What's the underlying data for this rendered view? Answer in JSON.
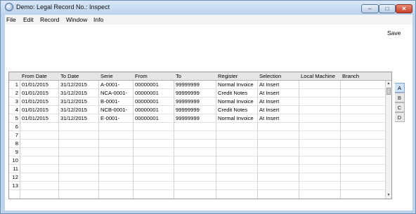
{
  "window": {
    "title": "Demo: Legal Record No.: Inspect"
  },
  "menubar": [
    "File",
    "Edit",
    "Record",
    "Window",
    "Info"
  ],
  "toolbar": {
    "save_label": "Save"
  },
  "grid": {
    "columns": [
      "From Date",
      "To Date",
      "Serie",
      "From",
      "To",
      "Register",
      "Selection",
      "Local Machine",
      "Branch"
    ],
    "rows": [
      {
        "num": "1",
        "cells": [
          "01/01/2015",
          "31/12/2015",
          "A-0001-",
          "00000001",
          "99999999",
          "Normal Invoice",
          "At Insert",
          "",
          ""
        ]
      },
      {
        "num": "2",
        "cells": [
          "01/01/2015",
          "31/12/2015",
          "NCA-0001-",
          "00000001",
          "99999999",
          "Credit Notes",
          "At Insert",
          "",
          ""
        ]
      },
      {
        "num": "3",
        "cells": [
          "01/01/2015",
          "31/12/2015",
          "B-0001-",
          "00000001",
          "99999999",
          "Normal Invoice",
          "At Insert",
          "",
          ""
        ]
      },
      {
        "num": "4",
        "cells": [
          "01/01/2015",
          "31/12/2015",
          "NCB-0001-",
          "00000001",
          "99999999",
          "Credit Notes",
          "At Insert",
          "",
          ""
        ]
      },
      {
        "num": "5",
        "cells": [
          "01/01/2015",
          "31/12/2015",
          "E-0001-",
          "00000001",
          "99999999",
          "Normal Invoice",
          "At Insert",
          "",
          ""
        ]
      },
      {
        "num": "6",
        "cells": [
          "",
          "",
          "",
          "",
          "",
          "",
          "",
          "",
          ""
        ]
      },
      {
        "num": "7",
        "cells": [
          "",
          "",
          "",
          "",
          "",
          "",
          "",
          "",
          ""
        ]
      },
      {
        "num": "8",
        "cells": [
          "",
          "",
          "",
          "",
          "",
          "",
          "",
          "",
          ""
        ]
      },
      {
        "num": "9",
        "cells": [
          "",
          "",
          "",
          "",
          "",
          "",
          "",
          "",
          ""
        ]
      },
      {
        "num": "10",
        "cells": [
          "",
          "",
          "",
          "",
          "",
          "",
          "",
          "",
          ""
        ]
      },
      {
        "num": "11",
        "cells": [
          "",
          "",
          "",
          "",
          "",
          "",
          "",
          "",
          ""
        ]
      },
      {
        "num": "12",
        "cells": [
          "",
          "",
          "",
          "",
          "",
          "",
          "",
          "",
          ""
        ]
      },
      {
        "num": "13",
        "cells": [
          "",
          "",
          "",
          "",
          "",
          "",
          "",
          "",
          ""
        ]
      }
    ]
  },
  "tabs": [
    {
      "label": "A",
      "active": true
    },
    {
      "label": "B",
      "active": false
    },
    {
      "label": "C",
      "active": false
    },
    {
      "label": "D",
      "active": false
    }
  ],
  "icons": {
    "app": "app-icon",
    "minimize": "minimize-icon",
    "maximize": "maximize-icon",
    "close": "close-icon",
    "scroll_up": "scroll-up-arrow-icon",
    "scroll_down": "scroll-down-arrow-icon"
  },
  "colors": {
    "title_bar": "#bcd3ec",
    "close_button": "#c7402a",
    "active_tab": "#cfe3f7"
  }
}
